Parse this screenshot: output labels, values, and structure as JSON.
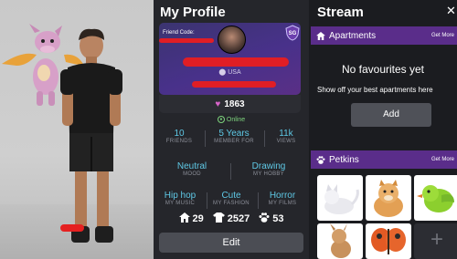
{
  "profile": {
    "title": "My Profile",
    "friend_code_label": "Friend Code:",
    "badge": "SG",
    "country": "USA",
    "hearts": "1863",
    "status": "Online",
    "stats": [
      {
        "value": "10",
        "label": "FRIENDS"
      },
      {
        "value": "5 Years",
        "label": "MEMBER FOR"
      },
      {
        "value": "11k",
        "label": "VIEWS"
      }
    ],
    "likes": [
      {
        "value": "Neutral",
        "label": "MOOD"
      },
      {
        "value": "Drawing",
        "label": "MY HOBBY"
      }
    ],
    "tastes": [
      {
        "value": "Hip hop",
        "label": "MY MUSIC"
      },
      {
        "value": "Cute",
        "label": "MY FASHION"
      },
      {
        "value": "Horror",
        "label": "MY FILMS"
      }
    ],
    "counters": [
      {
        "icon": "house-icon",
        "value": "29"
      },
      {
        "icon": "shirt-icon",
        "value": "2527"
      },
      {
        "icon": "paw-icon",
        "value": "53"
      }
    ],
    "edit_label": "Edit"
  },
  "stream": {
    "title": "Stream",
    "apartments": {
      "title": "Apartments",
      "more": "Get More",
      "empty_title": "No favourites yet",
      "empty_sub": "Show off your best apartments here",
      "add_label": "Add"
    },
    "petkins": {
      "title": "Petkins",
      "more": "Get More"
    }
  },
  "colors": {
    "accent_purple": "#5a2d8a",
    "stat_blue": "#5fc9e6",
    "online_green": "#7dd37d",
    "redact_red": "#e01e25"
  }
}
